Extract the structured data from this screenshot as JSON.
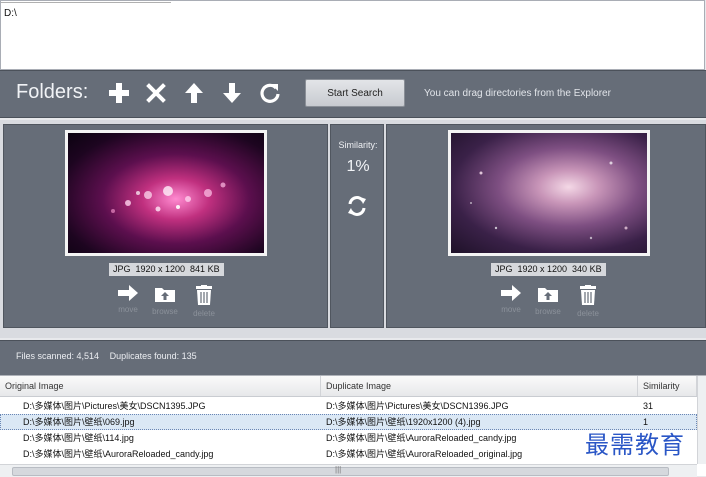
{
  "folder_list": {
    "path": "D:\\"
  },
  "toolbar": {
    "folders_label": "Folders:",
    "icons": [
      "plus-icon",
      "x-icon",
      "arrow-up-icon",
      "arrow-down-icon",
      "refresh-icon"
    ],
    "start_search_label": "Start Search",
    "drag_hint": "You can drag directories from the Explorer"
  },
  "compare": {
    "left": {
      "info": "JPG  1920 x 1200  841 KB",
      "actions": [
        "move",
        "browse",
        "delete"
      ]
    },
    "similarity_label": "Similarity:",
    "similarity_value": "1%",
    "right": {
      "info": "JPG  1920 x 1200  340 KB",
      "actions": [
        "move",
        "browse",
        "delete"
      ]
    }
  },
  "status": {
    "files_scanned": "Files scanned: 4,514",
    "duplicates_found": "Duplicates found: 135"
  },
  "table": {
    "columns": [
      "Original Image",
      "Duplicate Image",
      "Similarity"
    ],
    "rows": [
      {
        "original": "D:\\多媒体\\图片\\Pictures\\美女\\DSCN1395.JPG",
        "duplicate": "D:\\多媒体\\图片\\Pictures\\美女\\DSCN1396.JPG",
        "similarity": "31"
      },
      {
        "original": "D:\\多媒体\\图片\\壁纸\\069.jpg",
        "duplicate": "D:\\多媒体\\图片\\壁纸\\1920x1200 (4).jpg",
        "similarity": "1"
      },
      {
        "original": "D:\\多媒体\\图片\\壁纸\\114.jpg",
        "duplicate": "D:\\多媒体\\图片\\壁纸\\AuroraReloaded_candy.jpg",
        "similarity": ""
      },
      {
        "original": "D:\\多媒体\\图片\\壁纸\\AuroraReloaded_candy.jpg",
        "duplicate": "D:\\多媒体\\图片\\壁纸\\AuroraReloaded_original.jpg",
        "similarity": ""
      }
    ],
    "scroll_grip": "|||"
  },
  "watermark": "最需教育",
  "colors": {
    "toolbar_bg": "#666d78",
    "panel_bg": "#666d78",
    "selected_row": "#dbe8f5",
    "watermark": "#2a56c6"
  }
}
